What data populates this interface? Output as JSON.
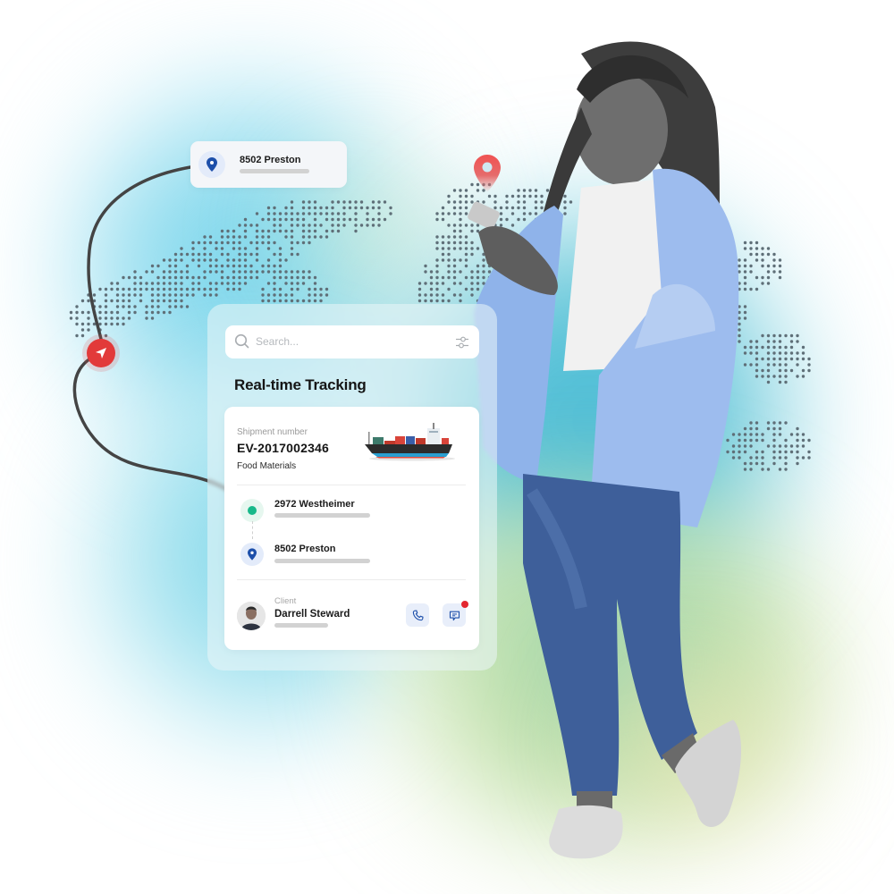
{
  "colors": {
    "accent_blue": "#1d4faa",
    "accent_red": "#e23a3a",
    "accent_green": "#19b98a",
    "bg_cyan": "#6fd3ea",
    "bg_teal": "#44b9d6",
    "bg_green": "#a6d8b0",
    "bg_yellow": "#ece5b0"
  },
  "icons": {
    "origin_pin": "map-pin-icon",
    "navigation": "navigation-arrow-icon",
    "destination_marker": "map-pin-icon",
    "search": "search-icon",
    "filter": "sliders-icon",
    "stop_current": "dot-icon",
    "stop_destination": "map-pin-icon",
    "call": "phone-icon",
    "message": "chat-icon"
  },
  "location_chip": {
    "title": "8502 Preston"
  },
  "tracking": {
    "search_placeholder": "Search...",
    "title": "Real-time Tracking",
    "shipment": {
      "label": "Shipment number",
      "number": "EV-2017002346",
      "cargo": "Food Materials",
      "image": "cargo-ship"
    },
    "stops": [
      {
        "title": "2972 Westheimer",
        "status": "current"
      },
      {
        "title": "8502 Preston",
        "status": "destination"
      }
    ],
    "client": {
      "label": "Client",
      "name": "Darrell Steward",
      "has_unread_message": true
    }
  }
}
